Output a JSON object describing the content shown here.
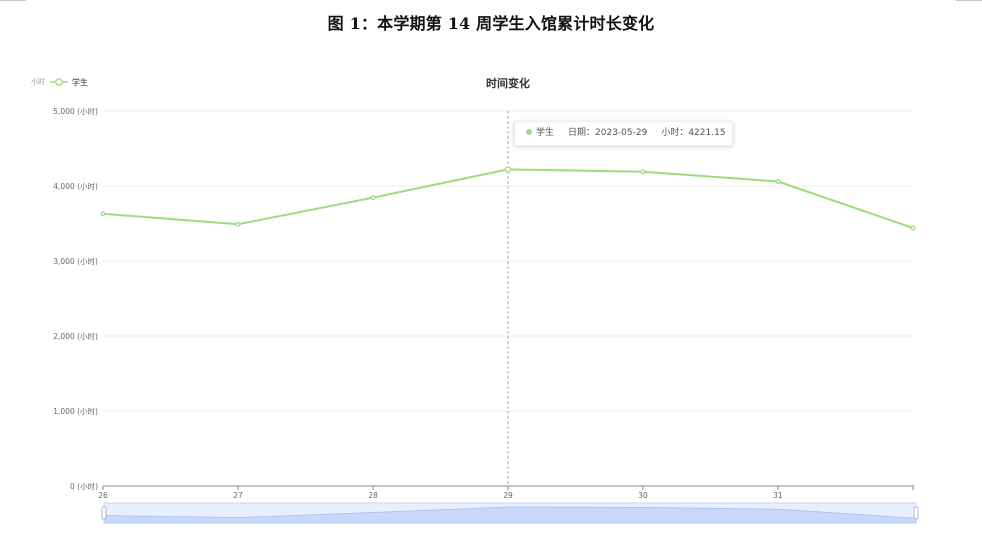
{
  "figure_title": "图 1：本学期第 14 周学生入馆累计时长变化",
  "chart_data": {
    "type": "line",
    "title": "时间变化",
    "x": [
      "26",
      "27",
      "28",
      "29",
      "30",
      "31",
      ""
    ],
    "series": [
      {
        "name": "学生",
        "values": [
          3630,
          3490,
          3845,
          4221.15,
          4190,
          4060,
          3440
        ]
      }
    ],
    "ylim": [
      0,
      5000
    ],
    "y_ticks": [
      {
        "value": 0,
        "label": "0 (小时)"
      },
      {
        "value": 1000,
        "label": "1,000 (小时)"
      },
      {
        "value": 2000,
        "label": "2,000 (小时)"
      },
      {
        "value": 3000,
        "label": "3,000 (小时)"
      },
      {
        "value": 4000,
        "label": "4,000 (小时)"
      },
      {
        "value": 5000,
        "label": "5,000 (小时)"
      }
    ],
    "grid": true,
    "legend_placement": "top-left",
    "line_color": "#9fdb83",
    "highlight_index": 3
  },
  "legend": {
    "prefix": "小时",
    "label": "学生"
  },
  "tooltip": {
    "series_name": "学生",
    "date_text": "日期：2023-05-29",
    "value_text": "小时：4221.15"
  },
  "colors": {
    "line": "#9fdb83",
    "grid": "#eeeeee",
    "axis": "#8a8a8a",
    "tick_text": "#666666",
    "slider_fill": "#e9efff",
    "slider_border": "#cad6f3",
    "slider_area": "#c7d8fb"
  }
}
